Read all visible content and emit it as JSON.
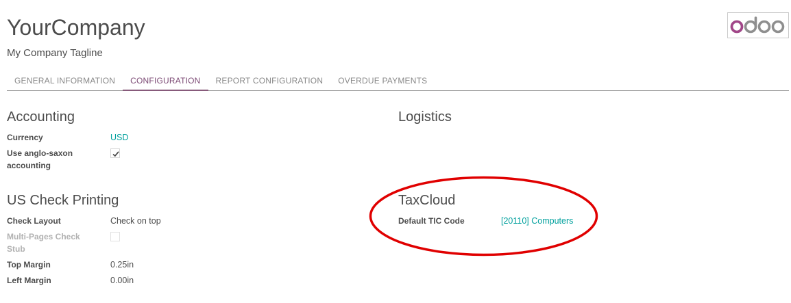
{
  "header": {
    "company_name": "YourCompany",
    "tagline": "My Company Tagline",
    "logo_text": "odoo"
  },
  "tabs": [
    {
      "label": "GENERAL INFORMATION",
      "active": false
    },
    {
      "label": "CONFIGURATION",
      "active": true
    },
    {
      "label": "REPORT CONFIGURATION",
      "active": false
    },
    {
      "label": "OVERDUE PAYMENTS",
      "active": false
    }
  ],
  "accounting": {
    "title": "Accounting",
    "currency_label": "Currency",
    "currency_value": "USD",
    "anglo_saxon_label": "Use anglo-saxon accounting",
    "anglo_saxon_checked": true
  },
  "check_printing": {
    "title": "US Check Printing",
    "layout_label": "Check Layout",
    "layout_value": "Check on top",
    "multi_pages_label": "Multi-Pages Check Stub",
    "multi_pages_checked": false,
    "top_margin_label": "Top Margin",
    "top_margin_value": "0.25in",
    "left_margin_label": "Left Margin",
    "left_margin_value": "0.00in"
  },
  "logistics": {
    "title": "Logistics"
  },
  "taxcloud": {
    "title": "TaxCloud",
    "tic_label": "Default TIC Code",
    "tic_value": "[20110] Computers"
  },
  "colors": {
    "brand": "#875a7b",
    "link": "#00a09d",
    "annotation": "#e00000"
  }
}
